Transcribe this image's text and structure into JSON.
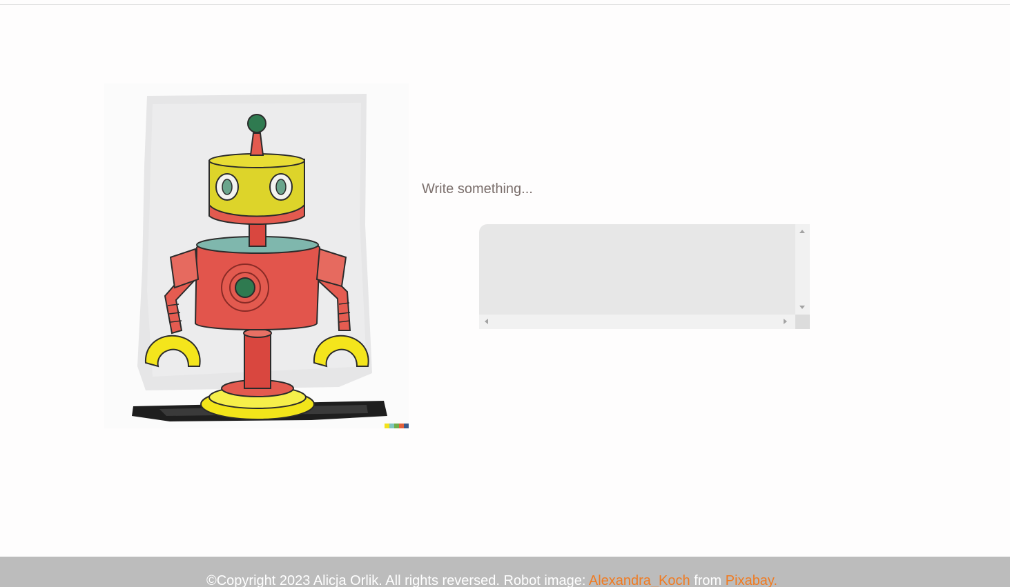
{
  "main": {
    "image": {
      "alt": "Robot"
    },
    "prompt_label": "Write something...",
    "textarea": {
      "value": "",
      "placeholder": ""
    }
  },
  "footer": {
    "copyright_text": "©Copyright 2023 Alicja Orlik. All rights reversed. Robot image: ",
    "author_link": "Alexandra_Koch",
    "from_text": " from ",
    "source_link": "Pixabay."
  },
  "colors": {
    "link": "#f07a20",
    "footer_background": "#bcbcbc",
    "textarea_background": "#e7e7e7"
  }
}
